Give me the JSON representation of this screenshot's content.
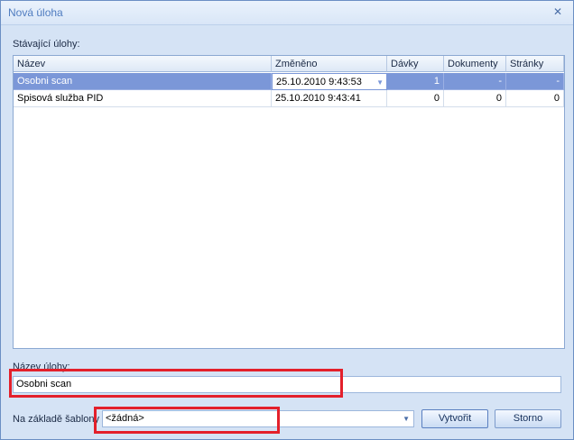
{
  "window": {
    "title": "Nová úloha",
    "close_icon": "close-icon"
  },
  "existing_tasks": {
    "label": "Stávající úlohy:",
    "columns": [
      "Název",
      "Změněno",
      "Dávky",
      "Dokumenty",
      "Stránky"
    ],
    "rows": [
      {
        "name": "Osobni scan",
        "modified": "25.10.2010 9:43:53",
        "batches": "1",
        "documents": "-",
        "pages": "-",
        "selected": true
      },
      {
        "name": "Spisová služba PID",
        "modified": "25.10.2010 9:43:41",
        "batches": "0",
        "documents": "0",
        "pages": "0",
        "selected": false
      }
    ]
  },
  "task_name": {
    "label": "Název úlohy:",
    "value": "Osobni scan"
  },
  "template": {
    "label": "Na základě šablony",
    "value": "<žádná>"
  },
  "buttons": {
    "create": "Vytvořit",
    "cancel": "Storno"
  },
  "colors": {
    "selection": "#7b97d8",
    "highlight": "#e3202b",
    "title": "#4f7cc0"
  }
}
